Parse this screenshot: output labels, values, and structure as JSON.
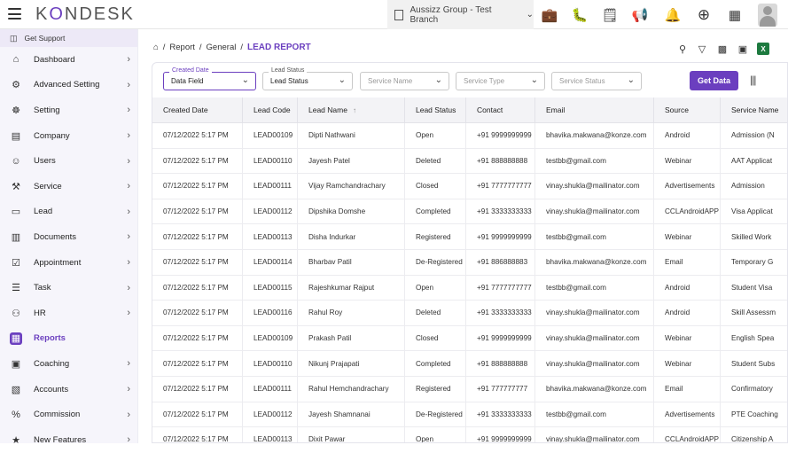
{
  "app": {
    "logo_prefix": "K",
    "logo_mid": "O",
    "logo_suffix": "NDESK",
    "branch": "Aussizz Group - Test Branch"
  },
  "top_icons": [
    "briefcase-icon",
    "bug-icon",
    "note-icon",
    "megaphone-icon",
    "bell-icon",
    "plus-circle-icon",
    "apps-grid-icon"
  ],
  "sidebar": {
    "support": "Get Support",
    "items": [
      {
        "label": "Dashboard",
        "icon": "home-icon"
      },
      {
        "label": "Advanced Setting",
        "icon": "gear-icon"
      },
      {
        "label": "Setting",
        "icon": "settings-icon"
      },
      {
        "label": "Company",
        "icon": "building-icon"
      },
      {
        "label": "Users",
        "icon": "users-icon"
      },
      {
        "label": "Service",
        "icon": "service-icon"
      },
      {
        "label": "Lead",
        "icon": "lead-icon"
      },
      {
        "label": "Documents",
        "icon": "document-icon"
      },
      {
        "label": "Appointment",
        "icon": "calendar-check-icon"
      },
      {
        "label": "Task",
        "icon": "task-icon"
      },
      {
        "label": "HR",
        "icon": "hr-icon"
      },
      {
        "label": "Reports",
        "icon": "reports-icon"
      },
      {
        "label": "Coaching",
        "icon": "coaching-icon"
      },
      {
        "label": "Accounts",
        "icon": "accounts-icon"
      },
      {
        "label": "Commission",
        "icon": "percent-icon"
      },
      {
        "label": "New Features",
        "icon": "star-icon"
      }
    ]
  },
  "breadcrumb": {
    "level1": "Report",
    "level2": "General",
    "current": "LEAD REPORT"
  },
  "filters": {
    "created_date": {
      "label": "Created Date",
      "value": "Data Field"
    },
    "lead_status": {
      "label": "Lead Status",
      "value": "Lead Status"
    },
    "service_name": {
      "placeholder": "Service Name"
    },
    "service_type": {
      "placeholder": "Service Type"
    },
    "service_status": {
      "placeholder": "Service Status"
    },
    "get_data": "Get Data"
  },
  "table": {
    "headers": [
      "Created Date",
      "Lead Code",
      "Lead Name",
      "Lead Status",
      "Contact",
      "Email",
      "Source",
      "Service Name"
    ],
    "rows": [
      [
        "07/12/2022 5:17 PM",
        "LEAD00109",
        "Dipti Nathwani",
        "Open",
        "+91 9999999999",
        "bhavika.makwana@konze.com",
        "Android",
        "Admission (N"
      ],
      [
        "07/12/2022 5:17 PM",
        "LEAD00110",
        "Jayesh Patel",
        "Deleted",
        "+91 888888888",
        "testbb@gmail.com",
        "Webinar",
        "AAT Applicat"
      ],
      [
        "07/12/2022 5:17 PM",
        "LEAD00111",
        "Vijay Ramchandrachary",
        "Closed",
        "+91 7777777777",
        "vinay.shukla@mailinator.com",
        "Advertisements",
        "Admission"
      ],
      [
        "07/12/2022 5:17 PM",
        "LEAD00112",
        "Dipshika Domshe",
        "Completed",
        "+91 3333333333",
        "vinay.shukla@mailinator.com",
        "CCLAndroidAPP",
        "Visa Applicat"
      ],
      [
        "07/12/2022 5:17 PM",
        "LEAD00113",
        "Disha Indurkar",
        "Registered",
        "+91 9999999999",
        "testbb@gmail.com",
        "Webinar",
        "Skilled Work"
      ],
      [
        "07/12/2022 5:17 PM",
        "LEAD00114",
        "Bharbav Patil",
        "De-Registered",
        "+91 886888883",
        "bhavika.makwana@konze.com",
        "Email",
        "Temporary G"
      ],
      [
        "07/12/2022 5:17 PM",
        "LEAD00115",
        "Rajeshkumar Rajput",
        "Open",
        "+91 7777777777",
        "testbb@gmail.com",
        "Android",
        "Student Visa"
      ],
      [
        "07/12/2022 5:17 PM",
        "LEAD00116",
        "Rahul Roy",
        "Deleted",
        "+91 3333333333",
        "vinay.shukla@mailinator.com",
        "Android",
        "Skill Assessm"
      ],
      [
        "07/12/2022 5:17 PM",
        "LEAD00109",
        "Prakash Patil",
        "Closed",
        "+91 9999999999",
        "vinay.shukla@mailinator.com",
        "Webinar",
        "English Spea"
      ],
      [
        "07/12/2022 5:17 PM",
        "LEAD00110",
        "Nikunj Prajapati",
        "Completed",
        "+91 888888888",
        "vinay.shukla@mailinator.com",
        "Webinar",
        "Student Subs"
      ],
      [
        "07/12/2022 5:17 PM",
        "LEAD00111",
        "Rahul Hemchandrachary",
        "Registered",
        "+91 777777777",
        "bhavika.makwana@konze.com",
        "Email",
        "Confirmatory"
      ],
      [
        "07/12/2022 5:17 PM",
        "LEAD00112",
        "Jayesh Shamnanai",
        "De-Registered",
        "+91 3333333333",
        "testbb@gmail.com",
        "Advertisements",
        "PTE Coaching"
      ],
      [
        "07/12/2022 5:17 PM",
        "LEAD00113",
        "Dixit Pawar",
        "Open",
        "+91 9999999999",
        "vinay.shukla@mailinator.com",
        "CCLAndroidAPP",
        "Citizenship A"
      ]
    ]
  }
}
